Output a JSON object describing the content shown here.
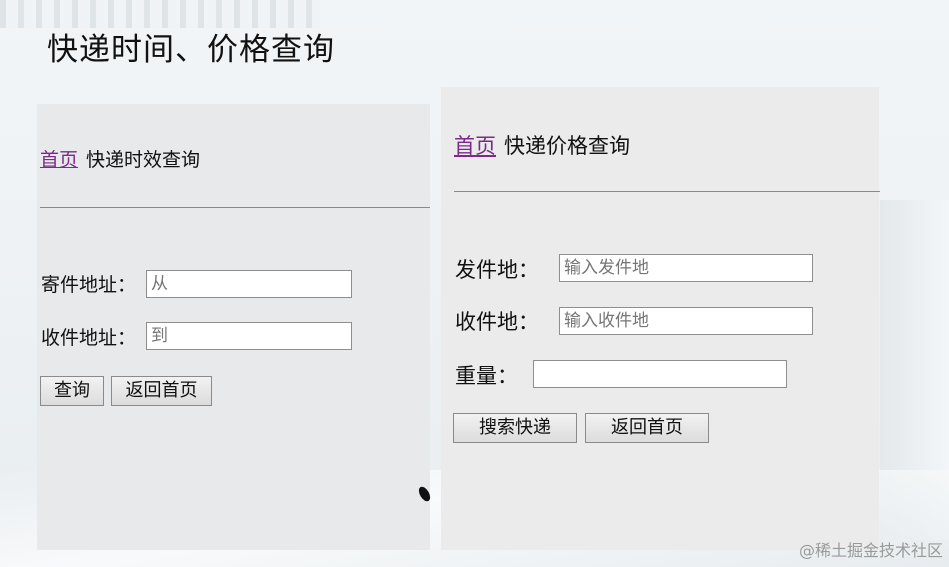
{
  "page_title": "快递时间、价格查询",
  "left_panel": {
    "breadcrumb_home": "首页",
    "breadcrumb_current": "快递时效查询",
    "sender_label": "寄件地址：",
    "sender_placeholder": "从",
    "receiver_label": "收件地址：",
    "receiver_placeholder": "到",
    "query_button": "查询",
    "back_button": "返回首页"
  },
  "right_panel": {
    "breadcrumb_home": "首页",
    "breadcrumb_current": "快递价格查询",
    "origin_label": "发件地：",
    "origin_placeholder": "输入发件地",
    "destination_label": "收件地：",
    "destination_placeholder": "输入收件地",
    "weight_label": "重量：",
    "weight_value": "",
    "search_button": "搜索快递",
    "back_button": "返回首页"
  },
  "watermark": "@稀土掘金技术社区",
  "colors": {
    "link": "#7b2a8a",
    "panel": "#e8e9ea"
  }
}
